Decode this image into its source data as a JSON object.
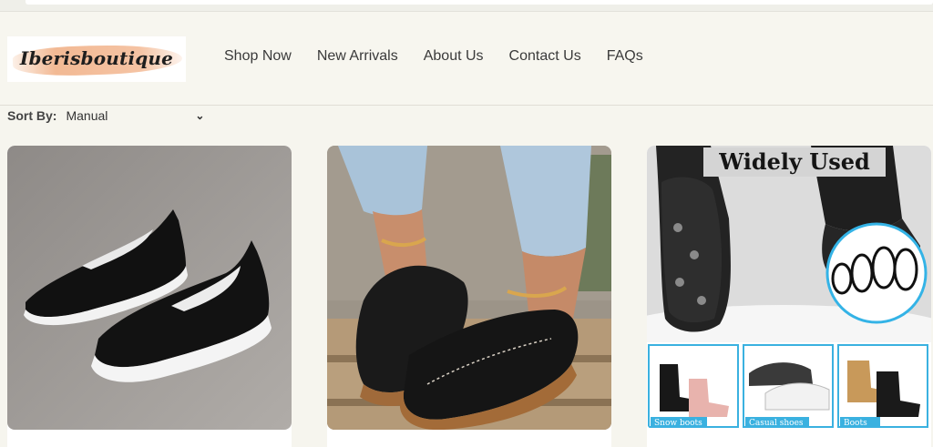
{
  "header": {
    "logo_text": "Iberisboutique",
    "nav": [
      {
        "label": "Shop Now"
      },
      {
        "label": "New Arrivals"
      },
      {
        "label": "About Us"
      },
      {
        "label": "Contact Us"
      },
      {
        "label": "FAQs"
      }
    ]
  },
  "sort": {
    "label": "Sort By:",
    "selected": "Manual",
    "icon": "chevron-down-icon"
  },
  "products": [
    {
      "image": "black knit slip-on sneakers on gray floor"
    },
    {
      "image": "black leather loafers with wedge sole on wooden steps"
    },
    {
      "image": "ice cleats for shoes",
      "banner": "Widely Used",
      "panels": [
        {
          "caption": "Snow boots"
        },
        {
          "caption": "Casual shoes"
        },
        {
          "caption": "Boots"
        }
      ]
    }
  ]
}
